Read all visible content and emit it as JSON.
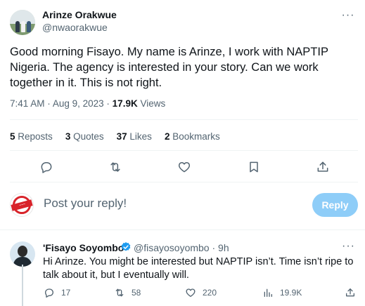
{
  "tweet": {
    "author_name": "Arinze Orakwue",
    "author_handle": "@nwaorakwue",
    "text": "Good morning Fisayo. My name is Arinze, I work with NAPTIP Nigeria. The agency is interested in your story. Can we work together in it. This is not right.",
    "time": "7:41 AM",
    "date": "Aug 9, 2023",
    "views_count": "17.9K",
    "views_label": "Views",
    "more_glyph": "···",
    "meta_separator": "·"
  },
  "stats": {
    "reposts_count": "5",
    "reposts_label": "Reposts",
    "quotes_count": "3",
    "quotes_label": "Quotes",
    "likes_count": "37",
    "likes_label": "Likes",
    "bookmarks_count": "2",
    "bookmarks_label": "Bookmarks"
  },
  "actions": {
    "icons": [
      "reply-icon",
      "repost-icon",
      "like-icon",
      "bookmark-icon",
      "share-icon"
    ]
  },
  "composer": {
    "placeholder": "Post your reply!",
    "button_label": "Reply"
  },
  "reply": {
    "author_name": "'Fisayo Soyombo",
    "author_handle": "@fisayosoyombo",
    "separator": "·",
    "time": "9h",
    "text": "Hi Arinze. You might be interested but NAPTIP isn’t. Time isn’t ripe to talk about it, but I eventually will.",
    "more_glyph": "···",
    "replies_count": "17",
    "reposts_count": "58",
    "likes_count": "220",
    "views_count": "19.9K"
  },
  "colors": {
    "text_primary": "#0f1419",
    "text_secondary": "#536471",
    "accent": "#1d9bf0",
    "reply_button_disabled": "#8ecdf8",
    "divider": "#eff3f4"
  }
}
